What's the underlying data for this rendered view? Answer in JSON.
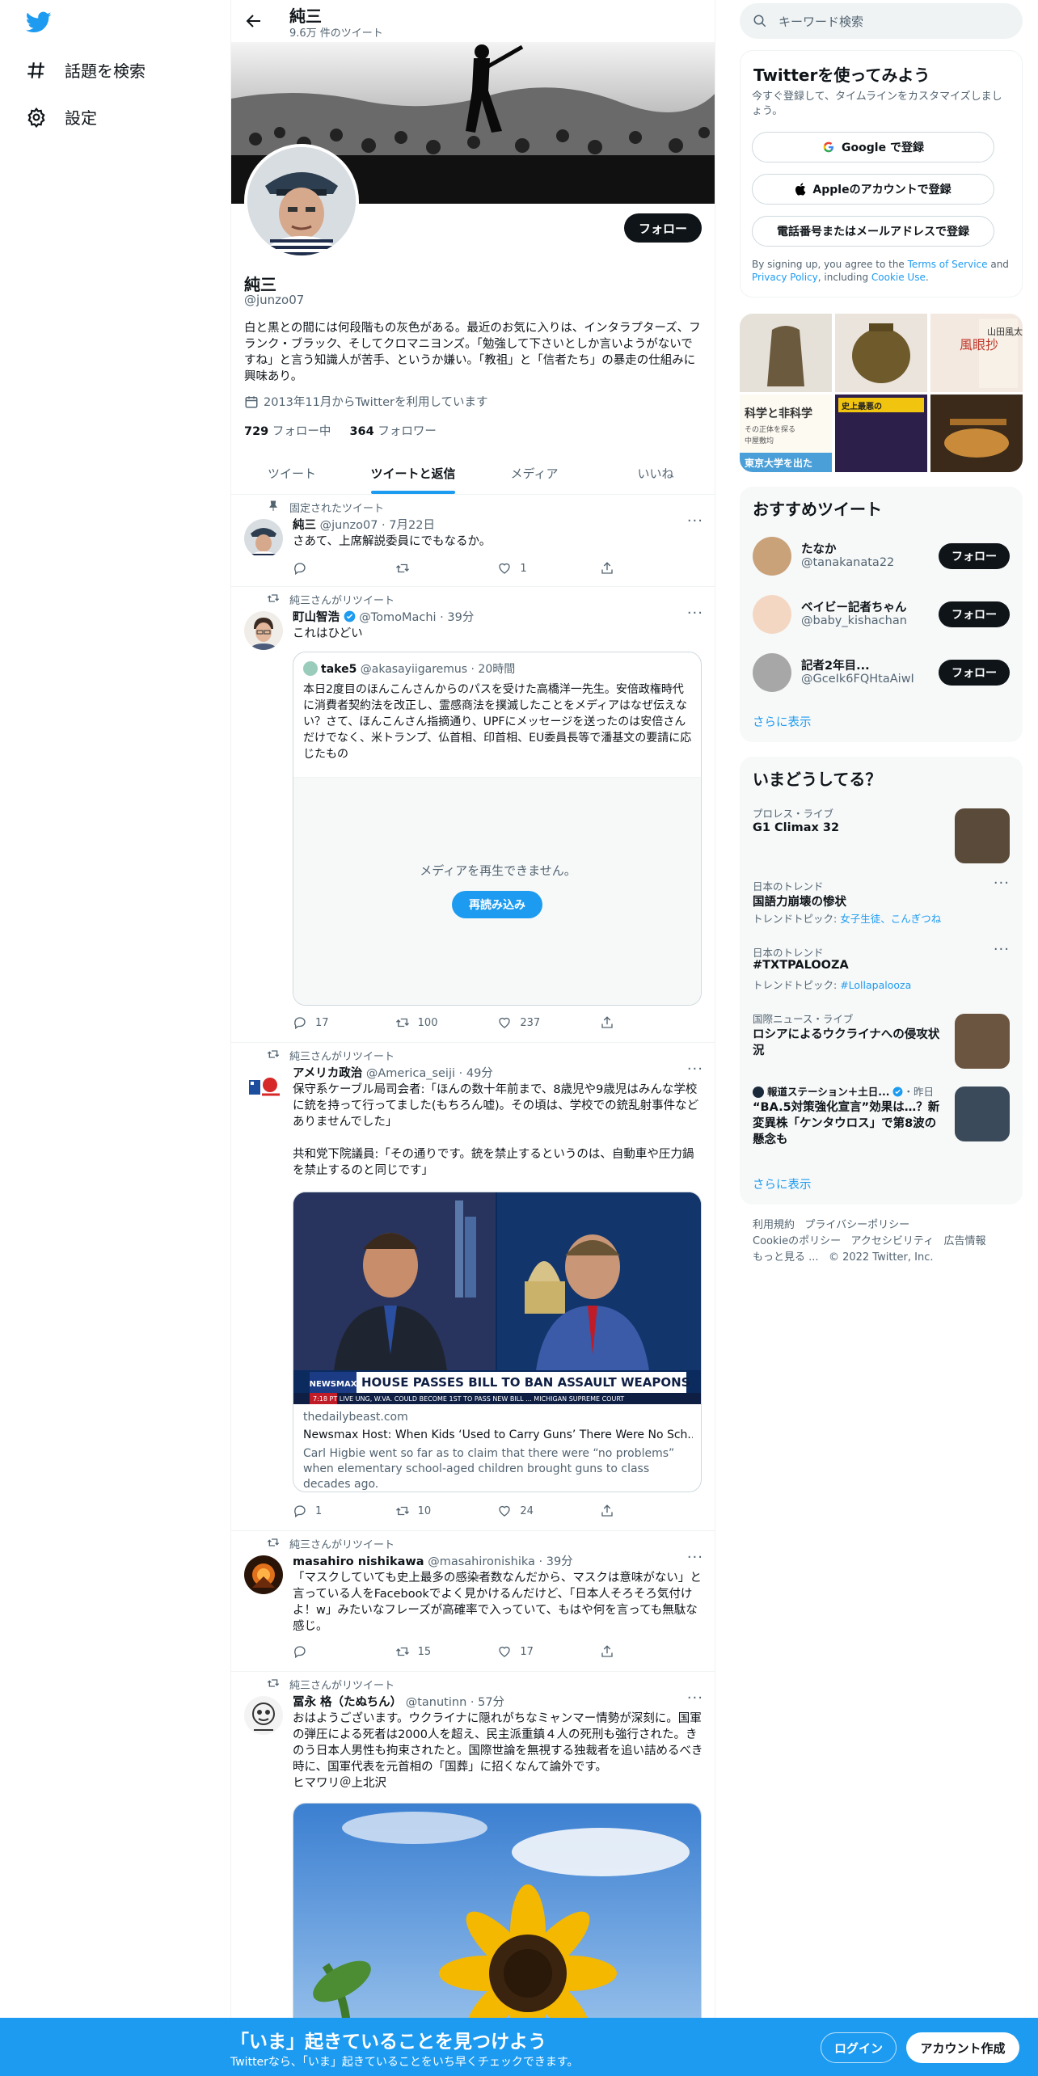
{
  "nav": {
    "explore": "話題を検索",
    "settings": "設定"
  },
  "header": {
    "name": "純三",
    "count": "9.6万 件のツイート"
  },
  "profile": {
    "name": "純三",
    "handle": "@junzo07",
    "follow": "フォロー",
    "bio": "白と黒との間には何段階もの灰色がある。最近のお気に入りは、インタラプターズ、フランク・ブラック、そしてクロマニヨンズ。「勉強して下さいとしか言いようがないですね」と言う知識人が苦手、というか嫌い。「教祖」と「信者たち」の暴走の仕組みに興味あり。",
    "joined": "2013年11月からTwitterを利用しています",
    "following_count": "729",
    "following_label": "フォロー中",
    "followers_count": "364",
    "followers_label": "フォロワー"
  },
  "tabs": [
    "ツイート",
    "ツイートと返信",
    "メディア",
    "いいね"
  ],
  "tweets": {
    "t1": {
      "context": "固定されたツイート",
      "name": "純三",
      "handle": "@junzo07",
      "time": "7月22日",
      "text": "さあて、上席解説委員にでもなるか。",
      "likes": "1"
    },
    "t2": {
      "context": "純三さんがリツイート",
      "name": "町山智浩",
      "handle": "@TomoMachi",
      "time": "39分",
      "text": "これはひどい",
      "quote": {
        "name": "take5",
        "handle": "@akasayiigaremus",
        "time": "20時間",
        "text": "本日2度目のほんこんさんからのパスを受けた高橋洋一先生。安倍政権時代に消費者契約法を改正し、霊感商法を撲滅したことをメディアはなぜ伝えない？さて、ほんこんさん指摘通り、UPFにメッセージを送ったのは安倍さんだけでなく、米トランプ、仏首相、印首相、EU委員長等で潘基文の要請に応じたもの",
        "error": "メディアを再生できません。",
        "reload": "再読み込み"
      },
      "replies": "17",
      "retweets": "100",
      "likes": "237"
    },
    "t3": {
      "context": "純三さんがリツイート",
      "name": "アメリカ政治",
      "handle": "@America_seiji",
      "time": "49分",
      "text": "保守系ケーブル局司会者:「ほんの数十年前まで、8歳児や9歳児はみんな学校に銃を持って行ってました(もちろん嘘)。その頃は、学校での銃乱射事件などありませんでした」\n\n共和党下院議員:「その通りです。銃を禁止するというのは、自動車や圧力鍋を禁止するのと同じです」",
      "card": {
        "banner": "HOUSE PASSES BILL TO BAN ASSAULT WEAPONS",
        "brand": "NEWSMAX",
        "ticker": "7:18 PT  LIVE    UNG, W.VA. COULD BECOME 1ST TO PASS NEW BILL ...    MICHIGAN SUPREME COURT",
        "domain": "thedailybeast.com",
        "title": "Newsmax Host: When Kids ‘Used to Carry Guns’ There Were No Sch...",
        "desc": "Carl Higbie went so far as to claim that there were “no problems” when elementary school-aged children brought guns to class decades ago."
      },
      "replies": "1",
      "retweets": "10",
      "likes": "24"
    },
    "t4": {
      "context": "純三さんがリツイート",
      "name": "masahiro nishikawa",
      "handle": "@masahironishika",
      "time": "39分",
      "text": "「マスクしていても史上最多の感染者数なんだから、マスクは意味がない」と言っている人をFacebookでよく見かけるんだけど、「日本人そろそろ気付けよ！w」みたいなフレーズが高確率で入っていて、もはや何を言っても無駄な感じ。",
      "retweets": "15",
      "likes": "17"
    },
    "t5": {
      "context": "純三さんがリツイート",
      "name": "冨永 格（たぬちん）",
      "handle": "@tanutinn",
      "time": "57分",
      "text": "おはようございます。ウクライナに隠れがちなミャンマー情勢が深刻に。国軍の弾圧による死者は2000人を超え、民主派重鎮４人の死刑も強行された。きのう日本人男性も拘束されたと。国際世論を無視する独裁者を追い詰めるべき時に、国軍代表を元首相の「国葬」に招くなんて論外です。\nヒマワリ＠上北沢"
    }
  },
  "search": {
    "placeholder": "キーワード検索"
  },
  "signup": {
    "title": "Twitterを使ってみよう",
    "subtitle": "今すぐ登録して、タイムラインをカスタマイズしましょう。",
    "google": "Google で登録",
    "apple": "Appleのアカウントで登録",
    "phone": "電話番号またはメールアドレスで登録",
    "terms_pre": "By signing up, you agree to the ",
    "terms": "Terms of Service",
    "and": " and ",
    "privacy": "Privacy Policy",
    "incl": ", including ",
    "cookie": "Cookie Use",
    "dot": "."
  },
  "media_grid": {
    "t1": "風眼抄",
    "t2": "山田風太郎",
    "t3": "科学と非科学",
    "t4": "その正体を探る",
    "t5": "中屋敷均",
    "t6": "東京大学を出た",
    "t7": "史上最悪の"
  },
  "recommend": {
    "title": "おすすめツイート",
    "users": [
      {
        "name": "たなか",
        "handle": "@tanakanata22"
      },
      {
        "name": "ベイビー記者ちゃん",
        "handle": "@baby_kishachan"
      },
      {
        "name": "記者2年目...",
        "handle": "@GceIk6FQHtaAiwI"
      }
    ],
    "follow": "フォロー",
    "more": "さらに表示"
  },
  "trends": {
    "title": "いまどうしてる？",
    "items": [
      {
        "meta": "プロレス・ライブ",
        "title": "G1 Climax 32"
      },
      {
        "meta": "日本のトレンド",
        "title": "国語力崩壊の惨状",
        "topic_pre": "トレンドトピック: ",
        "topic": "女子生徒、こんぎつね"
      },
      {
        "meta": "日本のトレンド",
        "title": "#TXTPALOOZA",
        "topic_pre": "トレンドトピック: ",
        "topic": "#Lollapalooza"
      },
      {
        "meta": "国際ニュース・ライブ",
        "title": "ロシアによるウクライナへの侵攻状況"
      },
      {
        "meta_name": "報道ステーション＋土日...",
        "meta_time": "・昨日",
        "title": "“BA.5対策強化宣言”効果は…？新変異株「ケンタウロス」で第8波の懸念も"
      }
    ],
    "more": "さらに表示"
  },
  "footer": {
    "terms": "利用規約",
    "privacy": "プライバシーポリシー",
    "cookie": "Cookieのポリシー",
    "access": "アクセシビリティ",
    "ads": "広告情報",
    "more": "もっと見る ...",
    "copy": "© 2022 Twitter, Inc."
  },
  "bottom": {
    "title": "「いま」起きていることを見つけよう",
    "subtitle": "Twitterなら、「いま」起きていることをいち早くチェックできます。",
    "login": "ログイン",
    "signup": "アカウント作成"
  }
}
